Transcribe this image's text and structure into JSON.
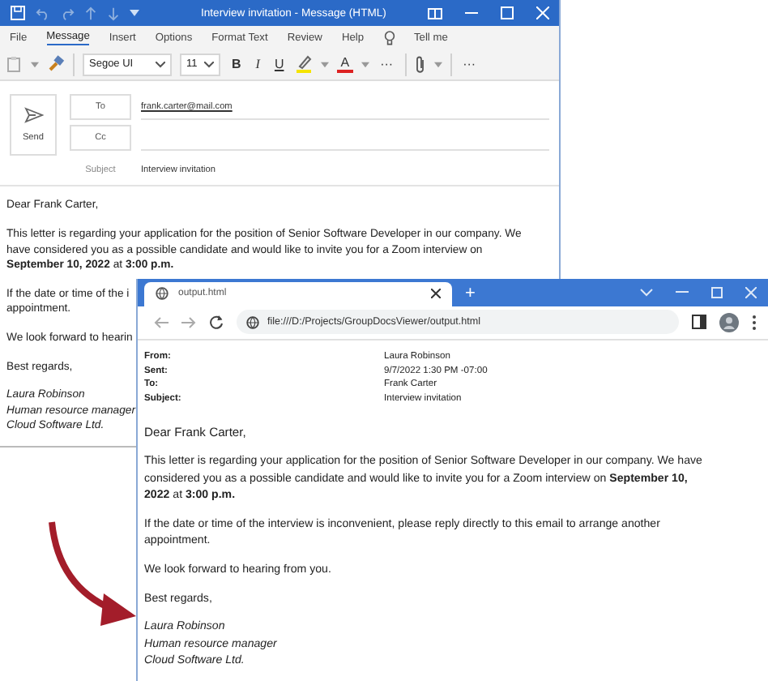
{
  "outlook": {
    "title": "Interview invitation  -  Message (HTML)",
    "menu": [
      {
        "label": "File",
        "selected": false
      },
      {
        "label": "Message",
        "selected": true
      },
      {
        "label": "Insert",
        "selected": false
      },
      {
        "label": "Options",
        "selected": false
      },
      {
        "label": "Format Text",
        "selected": false
      },
      {
        "label": "Review",
        "selected": false
      },
      {
        "label": "Help",
        "selected": false
      }
    ],
    "tell_me": "Tell me",
    "toolbar": {
      "font": "Segoe UI",
      "size": "11",
      "bold": "B",
      "italic": "I",
      "underline": "U",
      "font_color": "A",
      "more": "···",
      "overflow": "···"
    },
    "send": "Send",
    "to_button": "To",
    "cc_button": "Cc",
    "to_value": "frank.carter@mail.com",
    "subject_label": "Subject",
    "subject_value": "Interview invitation",
    "body": {
      "greeting": "Dear Frank Carter,",
      "paragraphs": [
        [
          "This letter is regarding your application for the position of Senior Software Developer in our company. We",
          "have considered you as a possible candidate and would like to invite you for a Zoom interview on",
          "**September 10, 2022** at **3:00 p.m.**"
        ],
        [
          "If the date or time of the i",
          "appointment."
        ],
        [
          "We look forward to hearin"
        ],
        [
          "Best regards,"
        ]
      ],
      "signature": [
        "Laura Robinson",
        "Human resource manager",
        "Cloud Software Ltd."
      ]
    }
  },
  "browser": {
    "tabs": [
      {
        "label": "output.html",
        "selected": true
      }
    ],
    "new_tab": "+",
    "url": "file:///D:/Projects/GroupDocsViewer/output.html",
    "headers": [
      {
        "label": "From:",
        "value": "Laura Robinson"
      },
      {
        "label": "Sent:",
        "value": "9/7/2022 1:30 PM -07:00"
      },
      {
        "label": "To:",
        "value": "Frank Carter"
      },
      {
        "label": "Subject:",
        "value": "Interview invitation"
      }
    ],
    "body": {
      "greeting": "Dear Frank Carter,",
      "paragraphs": [
        [
          "This letter is regarding your application for the position of Senior Software Developer in our company. We have",
          "considered you as a possible candidate and would like to invite you for a Zoom interview on **September 10,**",
          "**2022** at **3:00 p.m.**"
        ],
        [
          "If the date or time of the interview is inconvenient, please reply directly to this email to arrange another",
          "appointment."
        ],
        [
          "We look forward to hearing from you."
        ],
        [
          "Best regards,"
        ]
      ],
      "signature": [
        "Laura Robinson",
        "Human resource manager",
        "Cloud Software Ltd."
      ]
    }
  }
}
